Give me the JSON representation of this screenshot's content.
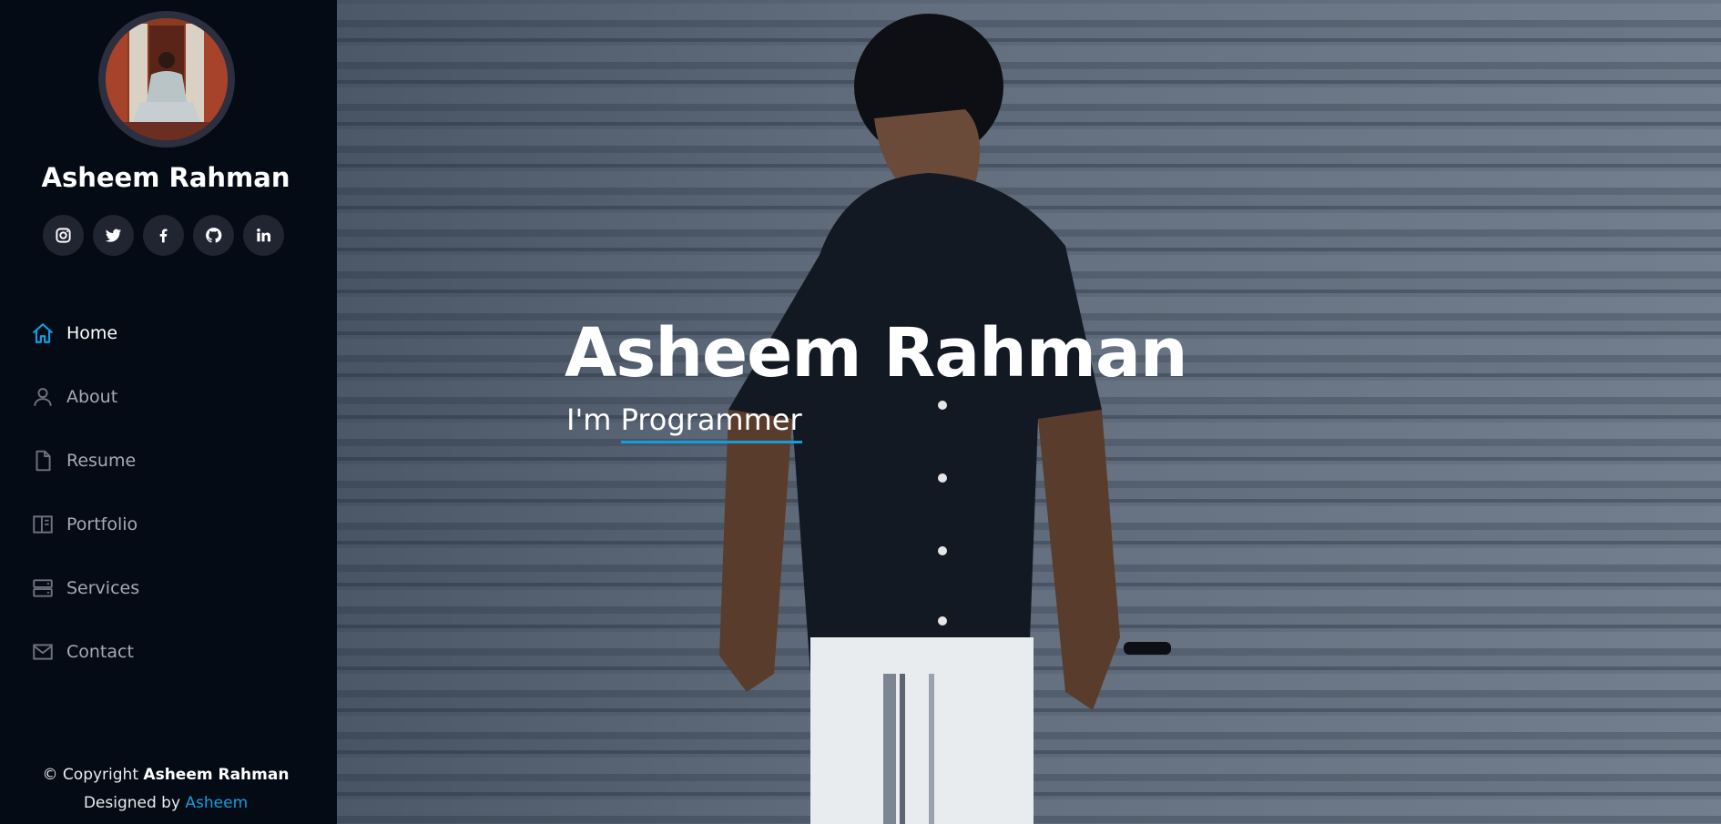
{
  "profile": {
    "name": "Asheem Rahman",
    "avatar_icon": "profile-photo"
  },
  "social": [
    {
      "name": "instagram-icon"
    },
    {
      "name": "twitter-icon"
    },
    {
      "name": "facebook-icon"
    },
    {
      "name": "github-icon"
    },
    {
      "name": "linkedin-icon"
    }
  ],
  "nav": {
    "items": [
      {
        "label": "Home",
        "icon": "home-icon",
        "active": true
      },
      {
        "label": "About",
        "icon": "person-icon"
      },
      {
        "label": "Resume",
        "icon": "file-icon"
      },
      {
        "label": "Portfolio",
        "icon": "book-icon"
      },
      {
        "label": "Services",
        "icon": "server-icon"
      },
      {
        "label": "Contact",
        "icon": "envelope-icon"
      }
    ]
  },
  "footer": {
    "copyright_prefix": "© Copyright",
    "copyright_name": "Asheem Rahman",
    "designed_prefix": "Designed by",
    "designed_link": "Asheem"
  },
  "hero": {
    "title": "Asheem Rahman",
    "sub_prefix": "I'm",
    "sub_typed": "Programmer"
  },
  "colors": {
    "accent": "#149ddd",
    "sidebar_bg": "#040b14",
    "social_bg": "#212431",
    "nav_text": "#a8a9b4"
  }
}
